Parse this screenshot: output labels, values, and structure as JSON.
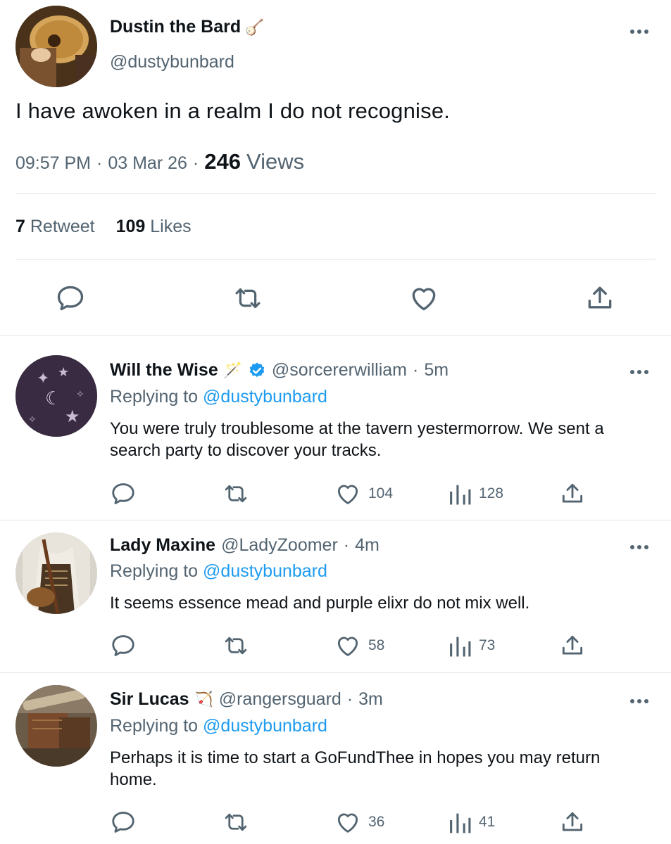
{
  "main_tweet": {
    "name": "Dustin the Bard",
    "name_emoji": "🪕",
    "handle": "@dustybunbard",
    "text": "I have awoken in a realm I do not recognise.",
    "time": "09:57 PM",
    "sep1": "·",
    "date": "03 Mar 26",
    "sep2": "·",
    "views_count": "246",
    "views_label": "Views",
    "retweets_count": "7",
    "retweets_label": "Retweet",
    "likes_count": "109",
    "likes_label": "Likes",
    "actions": [
      "reply-icon",
      "retweet-icon",
      "heart-icon",
      "share-icon"
    ]
  },
  "replies": [
    {
      "name": "Will the Wise",
      "name_emoji": "🪄",
      "verified": true,
      "handle": "@sorcererwilliam",
      "sep": "·",
      "time": "5m",
      "replying_label": "Replying to",
      "replying_handle": "@dustybunbard",
      "text": "You were truly troublesome at the tavern yestermorrow. We sent a search party to discover your tracks.",
      "likes": "104",
      "views": "128"
    },
    {
      "name": "Lady Maxine",
      "name_emoji": "",
      "verified": false,
      "handle": "@LadyZoomer",
      "sep": "·",
      "time": "4m",
      "replying_label": "Replying to",
      "replying_handle": "@dustybunbard",
      "text": "It seems essence mead and purple elixr do not mix well.",
      "likes": "58",
      "views": "73"
    },
    {
      "name": "Sir Lucas",
      "name_emoji": "🏹",
      "verified": false,
      "handle": "@rangersguard",
      "sep": "·",
      "time": "3m",
      "replying_label": "Replying to",
      "replying_handle": "@dustybunbard",
      "text": "Perhaps it is time to start a GoFundThee in hopes you may return home.",
      "likes": "36",
      "views": "41"
    }
  ],
  "colors": {
    "text": "#0f1419",
    "muted": "#536471",
    "link": "#1d9bf0",
    "divider": "#e1e6ea"
  }
}
